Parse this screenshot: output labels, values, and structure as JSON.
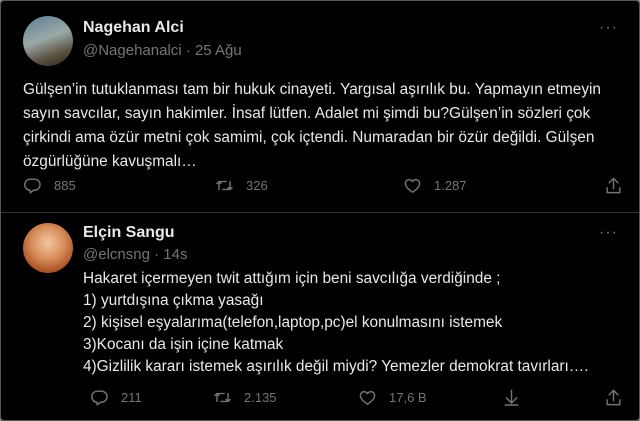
{
  "tweets": [
    {
      "name": "Nagehan Alci",
      "handle": "@Nagehanalci",
      "separator": "·",
      "time": "25 Ağu",
      "body": "Gülşen’in tutuklanması tam bir hukuk cinayeti. Yargısal aşırılık bu. Yapmayın etmeyin\nsayın savcılar, sayın hakimler. İnsaf lütfen. Adalet mi şimdi bu?Gülşen’in sözleri çok\nçirkindi ama özür metni çok samimi, çok içtendi. Numaradan bir özür değildi. Gülşen\nözgürlüğüne kavuşmalı…",
      "replies": "885",
      "retweets": "326",
      "likes": "1.287",
      "icons": [
        "reply-icon",
        "retweet-icon",
        "like-icon",
        "share-icon"
      ]
    },
    {
      "name": "Elçin Sangu",
      "handle": "@elcnsng",
      "separator": "·",
      "time": "14s",
      "body": "Hakaret içermeyen twit attığım için beni savcılığa verdiğinde ;\n1) yurtdışına çıkma yasağı\n2) kişisel eşyalarıma(telefon,laptop,pc)el konulmasını istemek\n3)Kocanı da işin içine katmak\n4)Gizlilik kararı istemek aşırılık değil miydi? Yemezler demokrat tavırları….",
      "replies": "211",
      "retweets": "2.135",
      "likes": "17,6 B",
      "icons": [
        "reply-icon",
        "retweet-icon",
        "like-icon",
        "analytics-icon",
        "share-icon"
      ]
    }
  ],
  "more_label": "···",
  "colors": {
    "background": "#000000",
    "text": "#e7e9ea",
    "secondary": "#71767b",
    "divider": "#2f3336"
  }
}
